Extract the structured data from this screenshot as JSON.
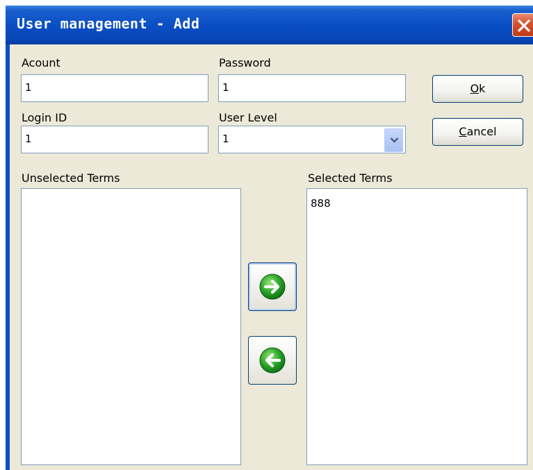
{
  "window": {
    "title": "User management - Add",
    "close_label": "close"
  },
  "form": {
    "account": {
      "label": "Acount",
      "value": "1"
    },
    "password": {
      "label": "Password",
      "value": "1"
    },
    "login_id": {
      "label": "Login ID",
      "value": "1"
    },
    "user_level": {
      "label": "User Level",
      "value": "1"
    }
  },
  "buttons": {
    "ok": {
      "mnemonic": "O",
      "rest": "k"
    },
    "cancel": {
      "mnemonic": "C",
      "rest": "ancel"
    }
  },
  "unselected": {
    "label": "Unselected Terms",
    "items": []
  },
  "selected": {
    "label": "Selected Terms",
    "items": [
      "888"
    ]
  },
  "icons": {
    "move_right": "arrow-right-icon",
    "move_left": "arrow-left-icon",
    "accent_green": "#2aa52a"
  }
}
